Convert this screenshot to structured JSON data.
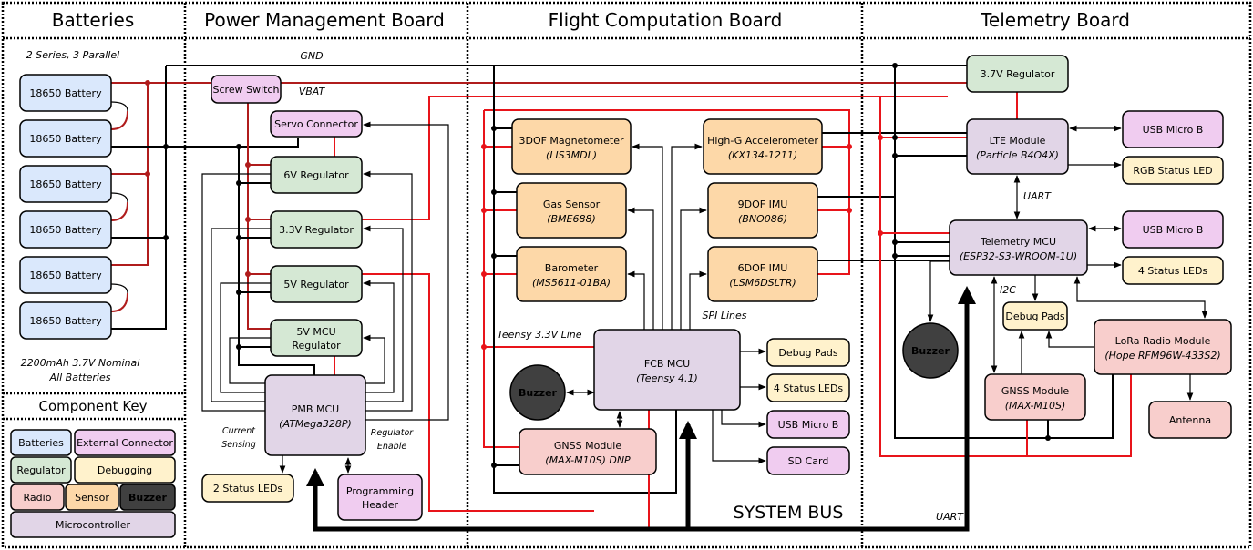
{
  "colors": {
    "battery": "#dae8fc",
    "regulator": "#d5e8d4",
    "external": "#f0ccf0",
    "debugging": "#fff2cc",
    "radio": "#f8cecc",
    "sensor": "#fdd8a8",
    "microcontroller": "#e1d5e7",
    "buzzer": "#404040",
    "power_line": "#e8141a",
    "ground_line": "#000000"
  },
  "sections": {
    "batteries": "Batteries",
    "pmb": "Power Management Board",
    "fcb": "Flight Computation Board",
    "telemetry": "Telemetry Board",
    "key": "Component Key"
  },
  "labels": {
    "config": "2 Series, 3 Parallel",
    "gnd": "GND",
    "vbat": "VBAT",
    "capacity1": "2200mAh 3.7V Nominal",
    "capacity2": "All Batteries",
    "current1": "Current",
    "current2": "Sensing",
    "enable1": "Regulator",
    "enable2": "Enable",
    "teensy_line": "Teensy 3.3V Line",
    "spi": "SPI Lines",
    "system_bus": "SYSTEM BUS",
    "uart_bus": "UART",
    "uart_lte": "UART",
    "i2c": "I2C"
  },
  "nodes": [
    {
      "id": "bat1",
      "type": "battery",
      "title": "18650 Battery"
    },
    {
      "id": "bat2",
      "type": "battery",
      "title": "18650 Battery"
    },
    {
      "id": "bat3",
      "type": "battery",
      "title": "18650 Battery"
    },
    {
      "id": "bat4",
      "type": "battery",
      "title": "18650 Battery"
    },
    {
      "id": "bat5",
      "type": "battery",
      "title": "18650 Battery"
    },
    {
      "id": "bat6",
      "type": "battery",
      "title": "18650 Battery"
    },
    {
      "id": "screw",
      "type": "external",
      "title": "Screw Switch"
    },
    {
      "id": "servo",
      "type": "external",
      "title": "Servo Connector"
    },
    {
      "id": "reg6",
      "type": "regulator",
      "title": "6V Regulator"
    },
    {
      "id": "reg33",
      "type": "regulator",
      "title": "3.3V Regulator"
    },
    {
      "id": "reg5",
      "type": "regulator",
      "title": "5V Regulator"
    },
    {
      "id": "reg5mcu",
      "type": "regulator",
      "title": "5V MCU",
      "title2": "Regulator"
    },
    {
      "id": "pmbmcu",
      "type": "microcontroller",
      "title": "PMB MCU",
      "sub": "(ATMega328P)"
    },
    {
      "id": "pmbled",
      "type": "debugging",
      "title": "2 Status LEDs"
    },
    {
      "id": "proghdr",
      "type": "external",
      "title": "Programming",
      "title2": "Header"
    },
    {
      "id": "mag",
      "type": "sensor",
      "title": "3DOF Magnetometer",
      "sub": "(LIS3MDL)"
    },
    {
      "id": "gas",
      "type": "sensor",
      "title": "Gas Sensor",
      "sub": "(BME688)"
    },
    {
      "id": "baro",
      "type": "sensor",
      "title": "Barometer",
      "sub": "(MS5611-01BA)"
    },
    {
      "id": "highg",
      "type": "sensor",
      "title": "High-G Accelerometer",
      "sub": "(KX134-1211)"
    },
    {
      "id": "imu9",
      "type": "sensor",
      "title": "9DOF IMU",
      "sub": "(BNO086)"
    },
    {
      "id": "imu6",
      "type": "sensor",
      "title": "6DOF IMU",
      "sub": "(LSM6DSLTR)"
    },
    {
      "id": "fcbmcu",
      "type": "microcontroller",
      "title": "FCB MCU",
      "sub": "(Teensy 4.1)"
    },
    {
      "id": "fcbgnss",
      "type": "radio",
      "title": "GNSS Module",
      "sub": "(MAX-M10S) DNP"
    },
    {
      "id": "fcbdebug",
      "type": "debugging",
      "title": "Debug Pads"
    },
    {
      "id": "fcbled",
      "type": "debugging",
      "title": "4 Status LEDs"
    },
    {
      "id": "fcbusb",
      "type": "external",
      "title": "USB Micro B"
    },
    {
      "id": "sdcard",
      "type": "external",
      "title": "SD Card"
    },
    {
      "id": "reg37",
      "type": "regulator",
      "title": "3.7V Regulator"
    },
    {
      "id": "lte",
      "type": "microcontroller",
      "title": "LTE Module",
      "sub": "(Particle B4O4X)"
    },
    {
      "id": "lteusb",
      "type": "external",
      "title": "USB Micro B"
    },
    {
      "id": "rgb",
      "type": "debugging",
      "title": "RGB Status LED"
    },
    {
      "id": "tmcu",
      "type": "microcontroller",
      "title": "Telemetry MCU",
      "sub": "(ESP32-S3-WROOM-1U)"
    },
    {
      "id": "tusb",
      "type": "external",
      "title": "USB Micro B"
    },
    {
      "id": "tled",
      "type": "debugging",
      "title": "4 Status LEDs"
    },
    {
      "id": "tdebug",
      "type": "debugging",
      "title": "Debug Pads"
    },
    {
      "id": "tgnss",
      "type": "radio",
      "title": "GNSS Module",
      "sub": "(MAX-M10S)"
    },
    {
      "id": "lora",
      "type": "radio",
      "title": "LoRa Radio Module",
      "sub": "(Hope RFM96W-433S2)"
    },
    {
      "id": "antenna",
      "type": "radio",
      "title": "Antenna"
    }
  ],
  "buzzers": [
    {
      "id": "fcbbuzzer",
      "title": "Buzzer"
    },
    {
      "id": "tbuzzer",
      "title": "Buzzer"
    }
  ],
  "key": [
    {
      "type": "battery",
      "title": "Batteries"
    },
    {
      "type": "external",
      "title": "External Connector"
    },
    {
      "type": "regulator",
      "title": "Regulator"
    },
    {
      "type": "debugging",
      "title": "Debugging"
    },
    {
      "type": "radio",
      "title": "Radio"
    },
    {
      "type": "sensor",
      "title": "Sensor"
    },
    {
      "type": "buzzer",
      "title": "Buzzer"
    },
    {
      "type": "microcontroller",
      "title": "Microcontroller"
    }
  ]
}
